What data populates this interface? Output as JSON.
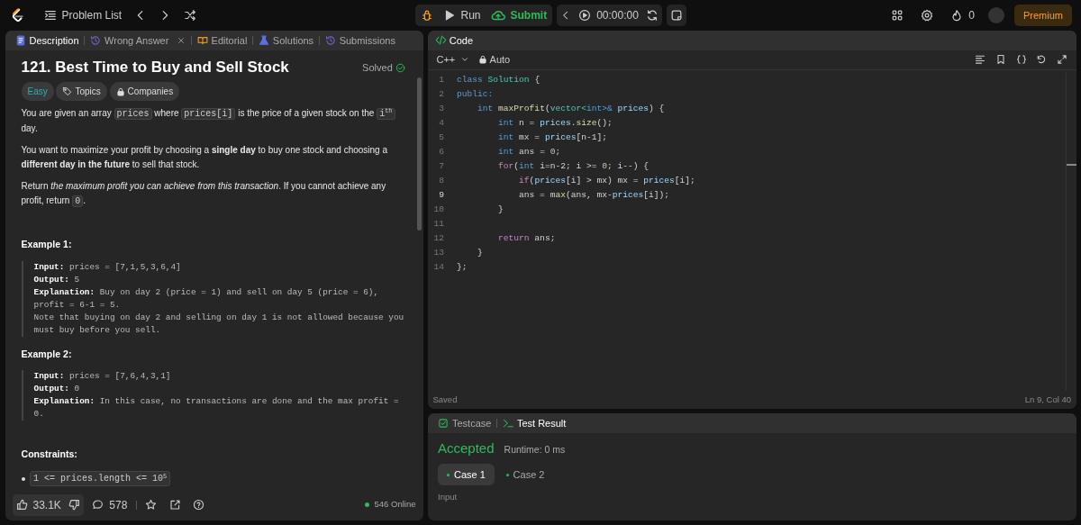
{
  "topbar": {
    "problem_list": "Problem List",
    "run": "Run",
    "submit": "Submit",
    "timer": "00:00:00",
    "streak": "0",
    "premium": "Premium"
  },
  "left_panel": {
    "tabs": [
      {
        "label": "Description",
        "kind": "description",
        "selected": true,
        "closable": false
      },
      {
        "label": "Wrong Answer",
        "kind": "result",
        "selected": false,
        "closable": true
      },
      {
        "label": "Editorial",
        "kind": "editorial",
        "selected": false,
        "closable": false
      },
      {
        "label": "Solutions",
        "kind": "solutions",
        "selected": false,
        "closable": false
      },
      {
        "label": "Submissions",
        "kind": "submissions",
        "selected": false,
        "closable": false
      }
    ],
    "title": "121. Best Time to Buy and Sell Stock",
    "status": "Solved",
    "tags": [
      {
        "label": "Easy",
        "kind": "difficulty"
      },
      {
        "label": "Topics",
        "kind": "topics"
      },
      {
        "label": "Companies",
        "kind": "companies"
      }
    ],
    "paragraphs": [
      [
        {
          "kind": "text",
          "text": "You are given an array "
        },
        {
          "kind": "code",
          "text": "prices"
        },
        {
          "kind": "text",
          "text": " where "
        },
        {
          "kind": "code",
          "text": "prices[i]"
        },
        {
          "kind": "text",
          "text": " is the price of a given stock on the "
        },
        {
          "kind": "code",
          "text": "i$^{th}$"
        },
        {
          "kind": "text",
          "text": " day."
        }
      ],
      [
        {
          "kind": "text",
          "text": "You want to maximize your profit by choosing a **single day** to buy one stock and choosing a **different day in the future** to sell that stock."
        }
      ],
      [
        {
          "kind": "text",
          "text": "Return *the maximum profit you can achieve from this transaction*. If you cannot achieve any profit, return "
        },
        {
          "kind": "code",
          "text": "0"
        },
        {
          "kind": "text",
          "text": "."
        }
      ]
    ],
    "examples": [
      {
        "title": "Example 1:",
        "text": "**Input:** prices = [7,1,5,3,6,4]\n**Output:** 5\n**Explanation:** Buy on day 2 (price = 1) and sell on day 5 (price = 6), profit = 6-1 = 5.\nNote that buying on day 2 and selling on day 1 is not allowed because you must buy before you sell."
      },
      {
        "title": "Example 2:",
        "text": "**Input:** prices = [7,6,4,3,1]\n**Output:** 0\n**Explanation:** In this case, no transactions are done and the max profit = 0."
      }
    ],
    "constraints_title": "Constraints:",
    "constraints": [
      "1 <= prices.length <= 10$^{5}$"
    ],
    "footer": {
      "likes": "33.1K",
      "comments": "578",
      "online": "546 Online"
    }
  },
  "code_panel": {
    "title": "Code",
    "language": "C++",
    "mode": "Auto",
    "lines": [
      {
        "number": "1",
        "current": false,
        "tokens": [
          {
            "kind": "kw",
            "text": "class"
          },
          {
            "kind": "type",
            "text": " Solution"
          },
          {
            "kind": "plain",
            "text": " {"
          }
        ]
      },
      {
        "number": "2",
        "current": false,
        "tokens": [
          {
            "kind": "kw",
            "text": "public:"
          }
        ]
      },
      {
        "number": "3",
        "current": false,
        "tokens": [
          {
            "kind": "kw",
            "text": "    int"
          },
          {
            "kind": "fn",
            "text": " maxProfit"
          },
          {
            "kind": "plain",
            "text": "("
          },
          {
            "kind": "type",
            "text": "vector<"
          },
          {
            "kind": "kw",
            "text": "int>&"
          },
          {
            "kind": "var",
            "text": " prices"
          },
          {
            "kind": "plain",
            "text": ") {"
          }
        ]
      },
      {
        "number": "4",
        "current": false,
        "tokens": [
          {
            "kind": "kw",
            "text": "        int"
          },
          {
            "kind": "plain",
            "text": " n = "
          },
          {
            "kind": "var",
            "text": "prices"
          },
          {
            "kind": "plain",
            "text": "."
          },
          {
            "kind": "fn",
            "text": "size"
          },
          {
            "kind": "plain",
            "text": "();"
          }
        ]
      },
      {
        "number": "5",
        "current": false,
        "tokens": [
          {
            "kind": "kw",
            "text": "        int"
          },
          {
            "kind": "plain",
            "text": " mx = "
          },
          {
            "kind": "var",
            "text": "prices"
          },
          {
            "kind": "plain",
            "text": "[n-1];"
          }
        ]
      },
      {
        "number": "6",
        "current": false,
        "tokens": [
          {
            "kind": "kw",
            "text": "        int"
          },
          {
            "kind": "plain",
            "text": " ans = "
          },
          {
            "kind": "num",
            "text": "0"
          },
          {
            "kind": "plain",
            "text": ";"
          }
        ]
      },
      {
        "number": "7",
        "current": false,
        "tokens": [
          {
            "kind": "ctrl",
            "text": "        for"
          },
          {
            "kind": "plain",
            "text": "("
          },
          {
            "kind": "kw",
            "text": "int"
          },
          {
            "kind": "plain",
            "text": " i=n-2; i >= "
          },
          {
            "kind": "num",
            "text": "0"
          },
          {
            "kind": "plain",
            "text": "; i--) {"
          }
        ]
      },
      {
        "number": "8",
        "current": false,
        "tokens": [
          {
            "kind": "ctrl",
            "text": "            if"
          },
          {
            "kind": "plain",
            "text": "("
          },
          {
            "kind": "var",
            "text": "prices"
          },
          {
            "kind": "plain",
            "text": "[i] > mx) mx = "
          },
          {
            "kind": "var",
            "text": "prices"
          },
          {
            "kind": "plain",
            "text": "[i];"
          }
        ]
      },
      {
        "number": "9",
        "current": true,
        "tokens": [
          {
            "kind": "plain",
            "text": "            ans = "
          },
          {
            "kind": "fn",
            "text": "max"
          },
          {
            "kind": "plain",
            "text": "(ans, mx-"
          },
          {
            "kind": "var",
            "text": "prices"
          },
          {
            "kind": "plain",
            "text": "[i]);"
          }
        ]
      },
      {
        "number": "10",
        "current": false,
        "tokens": [
          {
            "kind": "plain",
            "text": "        }"
          }
        ]
      },
      {
        "number": "11",
        "current": false
      },
      {
        "number": "12",
        "current": false,
        "tokens": [
          {
            "kind": "ctrl",
            "text": "        return"
          },
          {
            "kind": "plain",
            "text": " ans;"
          }
        ]
      },
      {
        "number": "13",
        "current": false,
        "tokens": [
          {
            "kind": "plain",
            "text": "    }"
          }
        ]
      },
      {
        "number": "14",
        "current": false,
        "tokens": [
          {
            "kind": "plain",
            "text": "};"
          }
        ]
      }
    ],
    "saved": "Saved",
    "cursor": "Ln 9, Col 40"
  },
  "test_panel": {
    "tabs": [
      {
        "label": "Testcase",
        "kind": "testcase",
        "selected": false
      },
      {
        "label": "Test Result",
        "kind": "result",
        "selected": true
      }
    ],
    "verdict": "Accepted",
    "runtime": "Runtime: 0 ms",
    "cases": [
      {
        "label": "Case 1",
        "selected": true
      },
      {
        "label": "Case 2",
        "selected": false
      }
    ],
    "input_label": "Input"
  }
}
